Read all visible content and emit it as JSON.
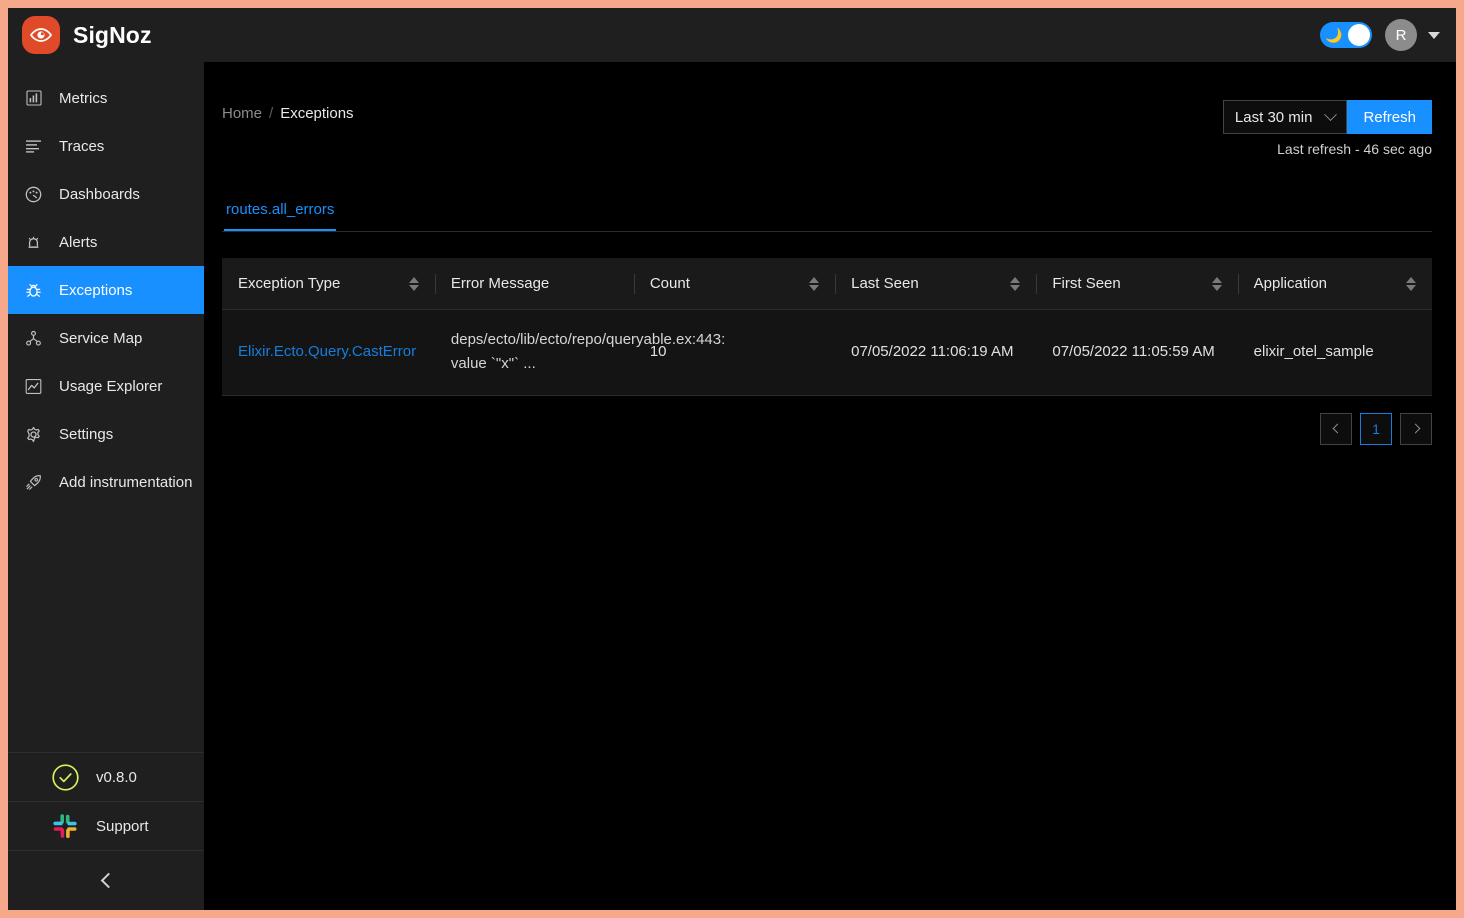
{
  "brand": {
    "name": "SigNoz",
    "logo_icon": "eye-icon",
    "logo_color": "#e04a28"
  },
  "header": {
    "theme_toggle": {
      "icon": "moon-icon",
      "state": "dark",
      "accent": "#1890ff"
    },
    "avatar_initial": "R",
    "caret_icon": "caret-down-icon"
  },
  "sidebar": {
    "items": [
      {
        "label": "Metrics",
        "icon": "bar-chart-icon",
        "active": false
      },
      {
        "label": "Traces",
        "icon": "list-lines-icon",
        "active": false
      },
      {
        "label": "Dashboards",
        "icon": "dashboard-gauge-icon",
        "active": false
      },
      {
        "label": "Alerts",
        "icon": "alert-bell-icon",
        "active": false
      },
      {
        "label": "Exceptions",
        "icon": "bug-icon",
        "active": true
      },
      {
        "label": "Service Map",
        "icon": "node-graph-icon",
        "active": false
      },
      {
        "label": "Usage Explorer",
        "icon": "line-chart-icon",
        "active": false
      },
      {
        "label": "Settings",
        "icon": "gear-icon",
        "active": false
      },
      {
        "label": "Add instrumentation",
        "icon": "rocket-icon",
        "active": false
      }
    ],
    "version": {
      "label": "v0.8.0",
      "icon": "check-circle-icon",
      "color": "#d3f25c"
    },
    "support": {
      "label": "Support",
      "icon": "slack-icon"
    },
    "collapse": {
      "icon": "chevron-left-icon"
    },
    "active_color": "#1890ff"
  },
  "breadcrumb": {
    "home": "Home",
    "separator": "/",
    "current": "Exceptions"
  },
  "time_controls": {
    "selected_range": "Last 30 min",
    "dropdown_icon": "chevron-down-icon",
    "refresh_label": "Refresh",
    "last_refresh": "Last refresh - 46 sec ago",
    "accent": "#1890ff"
  },
  "tabs": [
    {
      "label": "routes.all_errors",
      "active": true
    }
  ],
  "table": {
    "columns": [
      {
        "label": "Exception Type",
        "sortable": true
      },
      {
        "label": "Error Message",
        "sortable": false
      },
      {
        "label": "Count",
        "sortable": true
      },
      {
        "label": "Last Seen",
        "sortable": true
      },
      {
        "label": "First Seen",
        "sortable": true
      },
      {
        "label": "Application",
        "sortable": true
      }
    ],
    "rows": [
      {
        "exception_type": "Elixir.Ecto.Query.CastError",
        "error_message": "deps/ecto/lib/ecto/repo/queryable.ex:443: value `\"x\"` ...",
        "count": "10",
        "last_seen": "07/05/2022 11:06:19 AM",
        "first_seen": "07/05/2022 11:05:59 AM",
        "application": "elixir_otel_sample"
      }
    ]
  },
  "pagination": {
    "prev_icon": "chevron-left-icon",
    "next_icon": "chevron-right-icon",
    "pages": [
      "1"
    ],
    "current": "1"
  }
}
